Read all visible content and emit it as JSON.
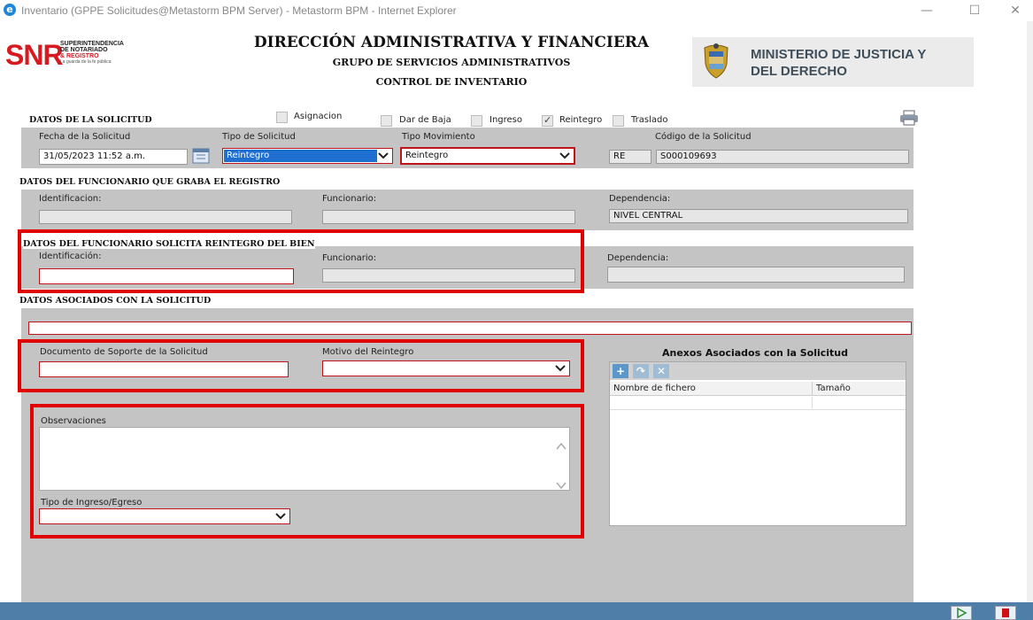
{
  "window": {
    "title": "Inventario (GPPE Solicitudes@Metastorm BPM Server) - Metastorm BPM - Internet Explorer",
    "minimize": "—",
    "maximize": "☐",
    "close": "✕"
  },
  "header": {
    "logo_big": "SNR",
    "logo_line1": "SUPERINTENDENCIA",
    "logo_line2": "DE NOTARIADO",
    "logo_line3": "& REGISTRO",
    "logo_line4": "La guarda de la fe pública",
    "title": "DIRECCIÓN ADMINISTRATIVA Y FINANCIERA",
    "subtitle1": "GRUPO DE SERVICIOS ADMINISTRATIVOS",
    "subtitle2": "CONTROL DE INVENTARIO",
    "ministerio": "MINISTERIO DE JUSTICIA Y\nDEL DERECHO"
  },
  "solicitud": {
    "section": "DATOS DE LA SOLICITUD",
    "chk_asignacion": "Asignacion",
    "chk_baja": "Dar de Baja",
    "chk_ingreso": "Ingreso",
    "chk_reintegro": "Reintegro",
    "chk_traslado": "Traslado",
    "fecha_label": "Fecha de la Solicitud",
    "fecha_value": "31/05/2023 11:52 a.m.",
    "tipo_label": "Tipo de Solicitud",
    "tipo_value": "Reintegro",
    "mov_label": "Tipo Movimiento",
    "mov_value": "Reintegro",
    "codigo_label": "Código de la Solicitud",
    "codigo_prefix": "RE",
    "codigo_value": "S000109693"
  },
  "graba": {
    "section": "DATOS DEL FUNCIONARIO QUE GRABA EL REGISTRO",
    "id_label": "Identificacion:",
    "func_label": "Funcionario:",
    "dep_label": "Dependencia:",
    "dep_value": "NIVEL CENTRAL"
  },
  "reintegro": {
    "section": "DATOS DEL FUNCIONARIO SOLICITA REINTEGRO DEL BIEN",
    "id_label": "Identificación:",
    "func_label": "Funcionario:",
    "dep_label": "Dependencia:"
  },
  "asociados": {
    "section": "DATOS ASOCIADOS CON LA SOLICITUD",
    "doc_label": "Documento de Soporte de la Solicitud",
    "motivo_label": "Motivo del Reintegro",
    "obs_label": "Observaciones",
    "tipo_ie_label": "Tipo de Ingreso/Egreso"
  },
  "anexos": {
    "title": "Anexos Asociados con la Solicitud",
    "col_nombre": "Nombre de fichero",
    "col_tamano": "Tamaño",
    "add": "+",
    "edit": "↷",
    "delete": "✕"
  },
  "colors": {
    "accent_red": "#e00000",
    "panel_gray": "#c4c4c4",
    "statusbar": "#4f7fa8"
  }
}
